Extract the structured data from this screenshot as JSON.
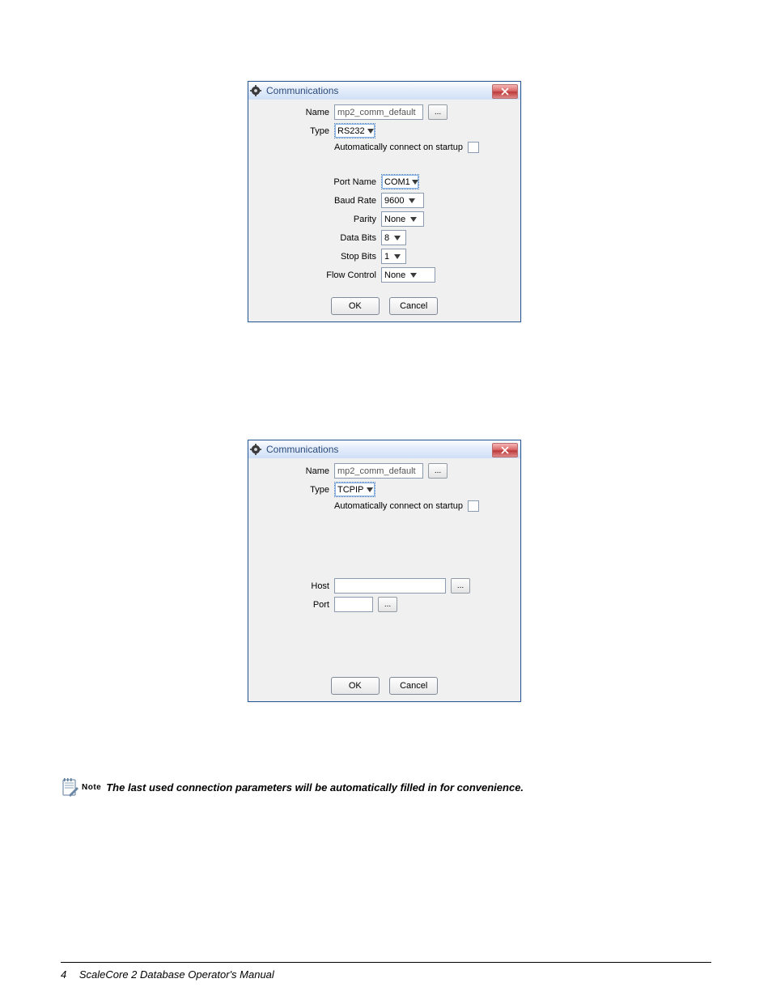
{
  "dialog1": {
    "title": "Communications",
    "name_label": "Name",
    "name_value": "mp2_comm_default",
    "type_label": "Type",
    "type_value": "RS232",
    "autoconnect_label": "Automatically connect on startup",
    "portname_label": "Port Name",
    "portname_value": "COM1",
    "baud_label": "Baud Rate",
    "baud_value": "9600",
    "parity_label": "Parity",
    "parity_value": "None",
    "databits_label": "Data Bits",
    "databits_value": "8",
    "stopbits_label": "Stop Bits",
    "stopbits_value": "1",
    "flow_label": "Flow Control",
    "flow_value": "None",
    "ok": "OK",
    "cancel": "Cancel",
    "dots": "..."
  },
  "dialog2": {
    "title": "Communications",
    "name_label": "Name",
    "name_value": "mp2_comm_default",
    "type_label": "Type",
    "type_value": "TCPIP",
    "autoconnect_label": "Automatically connect on startup",
    "host_label": "Host",
    "host_value": "",
    "port_label": "Port",
    "port_value": "",
    "ok": "OK",
    "cancel": "Cancel",
    "dots": "..."
  },
  "note": {
    "label": "Note",
    "text": "The last used connection parameters will be automatically filled in for convenience."
  },
  "footer": {
    "page": "4",
    "title": "ScaleCore 2 Database Operator's Manual"
  }
}
